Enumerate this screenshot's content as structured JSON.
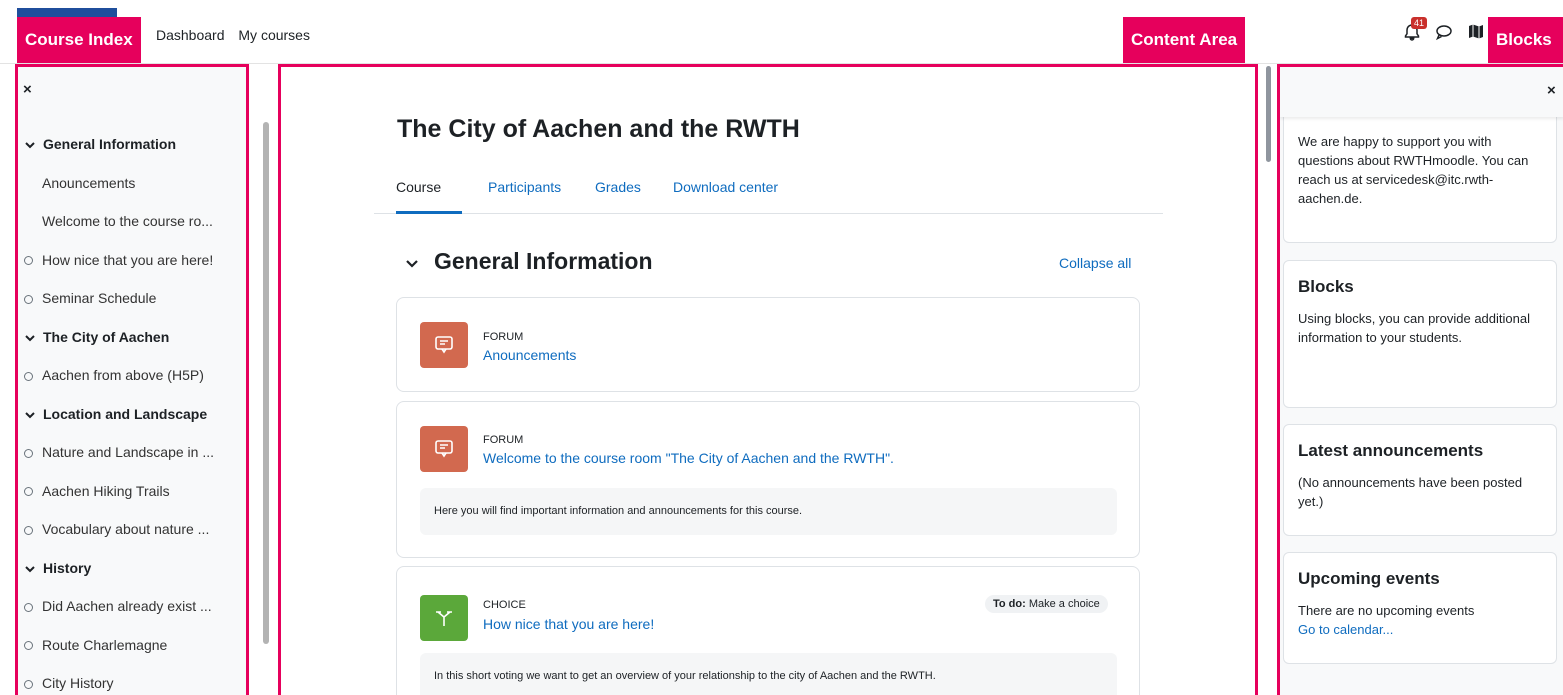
{
  "nav": {
    "dashboard": "Dashboard",
    "my_courses": "My courses",
    "notification_count": "41",
    "icons": [
      "bell-icon",
      "chat-icon",
      "map-icon"
    ]
  },
  "annotations": {
    "course_index": "Course Index",
    "content_area": "Content Area",
    "blocks": "Blocks"
  },
  "course_index": {
    "close": "×",
    "entries": [
      {
        "kind": "section",
        "label": "General Information"
      },
      {
        "kind": "item",
        "label": "Anouncements"
      },
      {
        "kind": "item",
        "label": "Welcome to the course ro..."
      },
      {
        "kind": "circle",
        "label": "How nice that you are here!"
      },
      {
        "kind": "circle",
        "label": "Seminar Schedule"
      },
      {
        "kind": "section",
        "label": "The City of Aachen"
      },
      {
        "kind": "circle",
        "label": "Aachen from above (H5P)"
      },
      {
        "kind": "section",
        "label": "Location and Landscape"
      },
      {
        "kind": "circle",
        "label": "Nature and Landscape in ..."
      },
      {
        "kind": "circle",
        "label": "Aachen Hiking Trails"
      },
      {
        "kind": "circle",
        "label": "Vocabulary about nature ..."
      },
      {
        "kind": "section",
        "label": "History"
      },
      {
        "kind": "circle",
        "label": "Did Aachen already exist ..."
      },
      {
        "kind": "circle",
        "label": "Route Charlemagne"
      },
      {
        "kind": "circle",
        "label": "City History"
      }
    ]
  },
  "content": {
    "title": "The City of Aachen and the RWTH",
    "tabs": [
      "Course",
      "Participants",
      "Grades",
      "Download center"
    ],
    "active_tab": "Course",
    "section_title": "General Information",
    "collapse_all": "Collapse all",
    "activities": [
      {
        "type": "FORUM",
        "name": "Anouncements"
      },
      {
        "type": "FORUM",
        "name": "Welcome to the course room \"The City of Aachen and the RWTH\".",
        "description": "Here you will find important information and announcements for this course."
      },
      {
        "type": "CHOICE",
        "name": "How nice that you are here!",
        "todo_label": "To do:",
        "todo_value": "Make a choice",
        "description": "In this short voting we want to get an overview of your relationship to the city of Aachen and the RWTH."
      }
    ]
  },
  "blocks": {
    "close": "×",
    "support_text": "We are happy to support you with questions about RWTHmoodle. You can reach us at servicedesk@itc.rwth-aachen.de.",
    "items": [
      {
        "title": "Blocks",
        "text": "Using blocks, you can provide additional information to your students."
      },
      {
        "title": "Latest announcements",
        "text": "(No announcements have been posted yet.)"
      },
      {
        "title": "Upcoming events",
        "text": "There are no upcoming events",
        "link": "Go to calendar..."
      }
    ]
  },
  "colors": {
    "annotation": "#e6005c",
    "link": "#0f6cbf",
    "forum_icon": "#d2694f",
    "choice_icon": "#5ba83a",
    "badge": "#c9302c"
  }
}
